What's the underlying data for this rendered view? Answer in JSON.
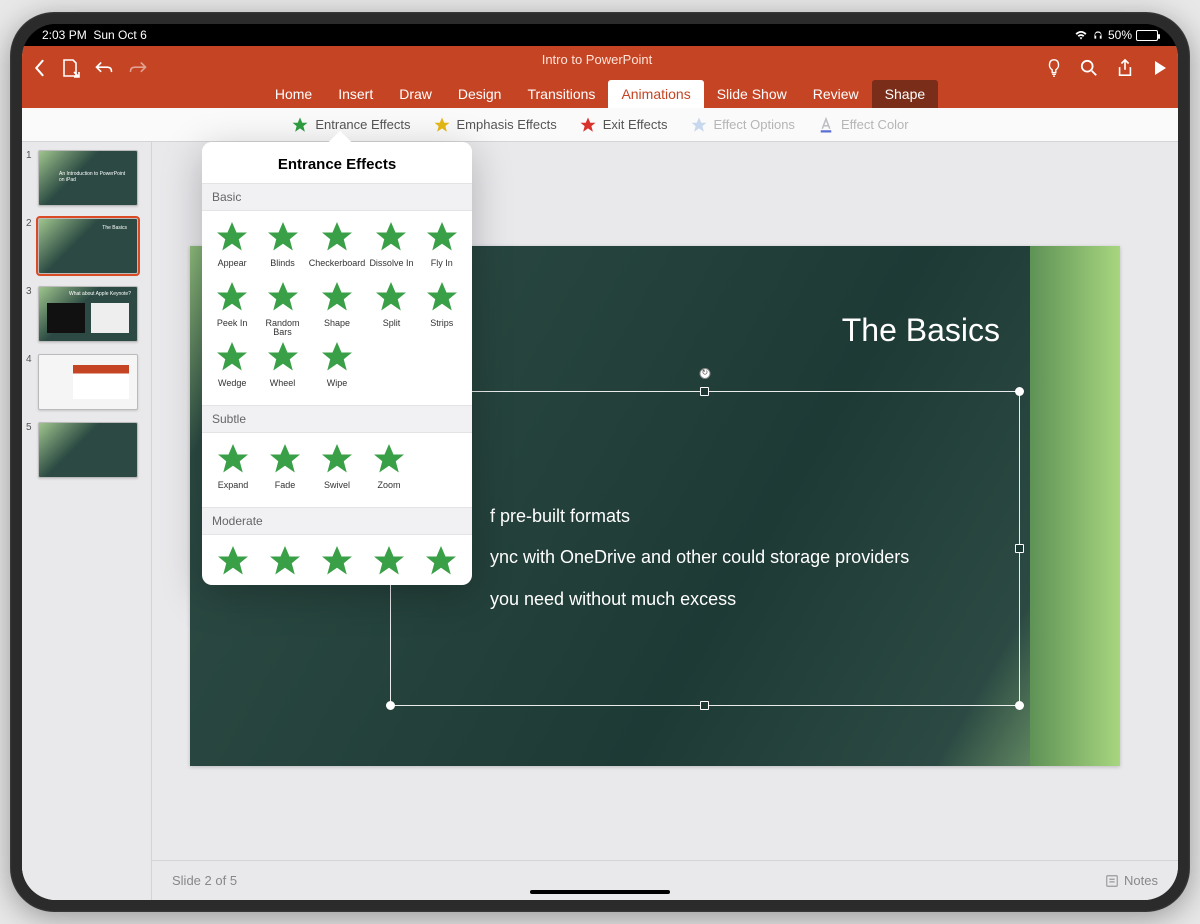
{
  "status": {
    "time": "2:03 PM",
    "date": "Sun Oct 6",
    "battery": "50%"
  },
  "document_title": "Intro to PowerPoint",
  "tabs": [
    "Home",
    "Insert",
    "Draw",
    "Design",
    "Transitions",
    "Animations",
    "Slide Show",
    "Review",
    "Shape"
  ],
  "active_tab": "Animations",
  "ribbon": {
    "entrance": "Entrance Effects",
    "emphasis": "Emphasis Effects",
    "exit": "Exit Effects",
    "options": "Effect Options",
    "color": "Effect Color"
  },
  "popover": {
    "title": "Entrance Effects",
    "sections": [
      {
        "name": "Basic",
        "effects": [
          "Appear",
          "Blinds",
          "Checkerboard",
          "Dissolve In",
          "Fly In",
          "Peek In",
          "Random Bars",
          "Shape",
          "Split",
          "Strips",
          "Wedge",
          "Wheel",
          "Wipe"
        ]
      },
      {
        "name": "Subtle",
        "effects": [
          "Expand",
          "Fade",
          "Swivel",
          "Zoom"
        ]
      },
      {
        "name": "Moderate",
        "effects": [
          "",
          "",
          "",
          "",
          ""
        ]
      }
    ]
  },
  "thumbnails": [
    {
      "n": "1",
      "title": "An Introduction to PowerPoint on iPad"
    },
    {
      "n": "2",
      "title": "The Basics",
      "selected": true
    },
    {
      "n": "3",
      "title": "What about Apple Keynote?"
    },
    {
      "n": "4",
      "title": ""
    },
    {
      "n": "5",
      "title": ""
    }
  ],
  "slide": {
    "title": "The Basics",
    "bullets": [
      "f pre-built formats",
      "ync with OneDrive and other could storage providers",
      "you need without much excess"
    ]
  },
  "footer": {
    "counter": "Slide 2 of 5",
    "notes": "Notes"
  }
}
